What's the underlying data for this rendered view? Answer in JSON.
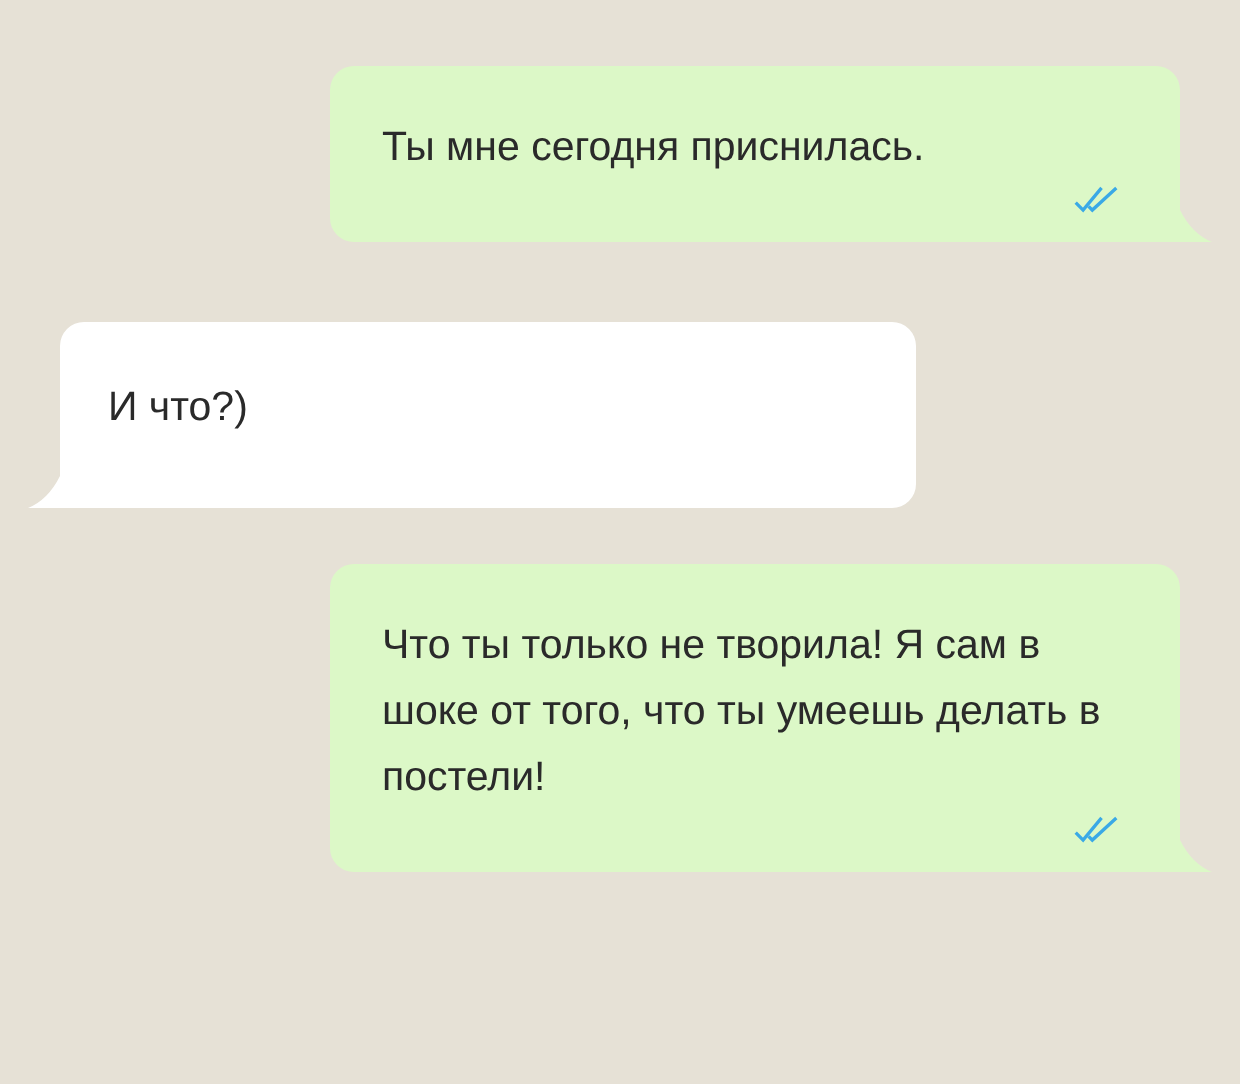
{
  "messages": [
    {
      "kind": "outgoing",
      "text": "Ты мне сегодня приснилась.",
      "read": true
    },
    {
      "kind": "incoming",
      "text": "И что?)"
    },
    {
      "kind": "outgoing",
      "text": "Что ты только не творила! Я сам в шоке от того, что ты умеешь делать в постели!",
      "read": true
    }
  ]
}
